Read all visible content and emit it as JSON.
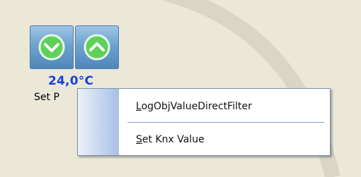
{
  "widget": {
    "temperature": "24,0°C",
    "label": "Set P",
    "buttons": {
      "decrease_icon": "chevron-down-circle-icon",
      "increase_icon": "chevron-up-circle-icon"
    }
  },
  "context_menu": {
    "items": [
      {
        "accel": "L",
        "rest": "ogObjValueDirectFilter"
      },
      {
        "accel": "S",
        "rest": "et Knx Value"
      }
    ]
  },
  "colors": {
    "background": "#ebe8d8",
    "temperature_text": "#1a3fe0",
    "menu_border": "#7b93b3",
    "gutter_gradient_end": "#a8c0e4"
  }
}
